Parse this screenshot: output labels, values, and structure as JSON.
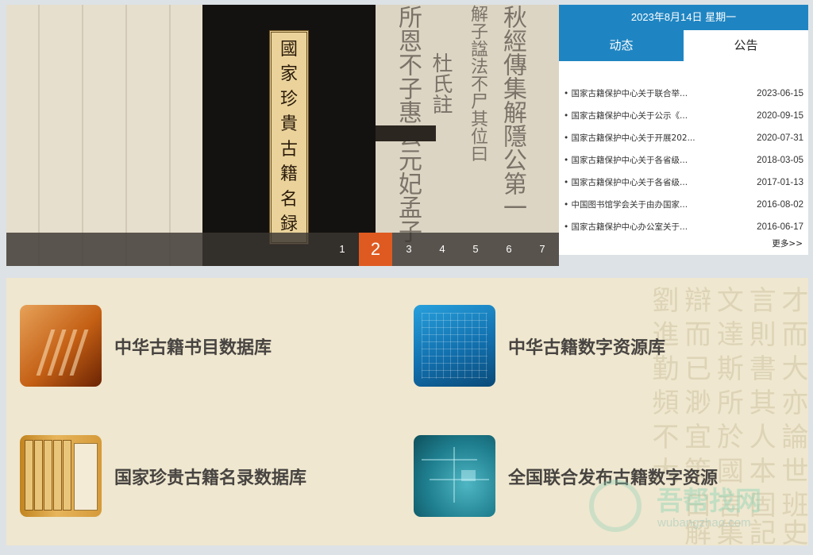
{
  "slider": {
    "book_title_chars": [
      "國",
      "家",
      "珍",
      "貴",
      "古",
      "籍",
      "名",
      "録"
    ],
    "pages": [
      "1",
      "2",
      "3",
      "4",
      "5",
      "6",
      "7"
    ],
    "active_page": "2"
  },
  "news": {
    "date": "2023年8月14日 星期一",
    "tabs": [
      "动态",
      "公告"
    ],
    "active_tab": "动态",
    "items": [
      {
        "title": "国家古籍保护中心关于联合举...",
        "date": "2023-06-15"
      },
      {
        "title": "国家古籍保护中心关于公示《...",
        "date": "2020-09-15"
      },
      {
        "title": "国家古籍保护中心关于开展202...",
        "date": "2020-07-31"
      },
      {
        "title": "国家古籍保护中心关于各省级...",
        "date": "2018-03-05"
      },
      {
        "title": "国家古籍保护中心关于各省级...",
        "date": "2017-01-13"
      },
      {
        "title": "中国图书馆学会关于由办国家...",
        "date": "2016-08-02"
      },
      {
        "title": "国家古籍保护中心办公室关于...",
        "date": "2016-06-17"
      }
    ],
    "more": "更多>>"
  },
  "databases": [
    {
      "name": "中华古籍书目数据库",
      "icon": "book-stack-icon"
    },
    {
      "name": "中华古籍数字资源库",
      "icon": "digital-archive-icon"
    },
    {
      "name": "国家珍贵古籍名录数据库",
      "icon": "rare-books-icon"
    },
    {
      "name": "全国联合发布古籍数字资源",
      "icon": "circuit-board-icon"
    }
  ],
  "watermark": {
    "cn": "吾帮找网",
    "en": "wubangzhao.com"
  },
  "colors": {
    "accent_blue": "#1f85c2",
    "active_page_orange": "#df5a21",
    "panel_bg": "#efe7cf"
  }
}
